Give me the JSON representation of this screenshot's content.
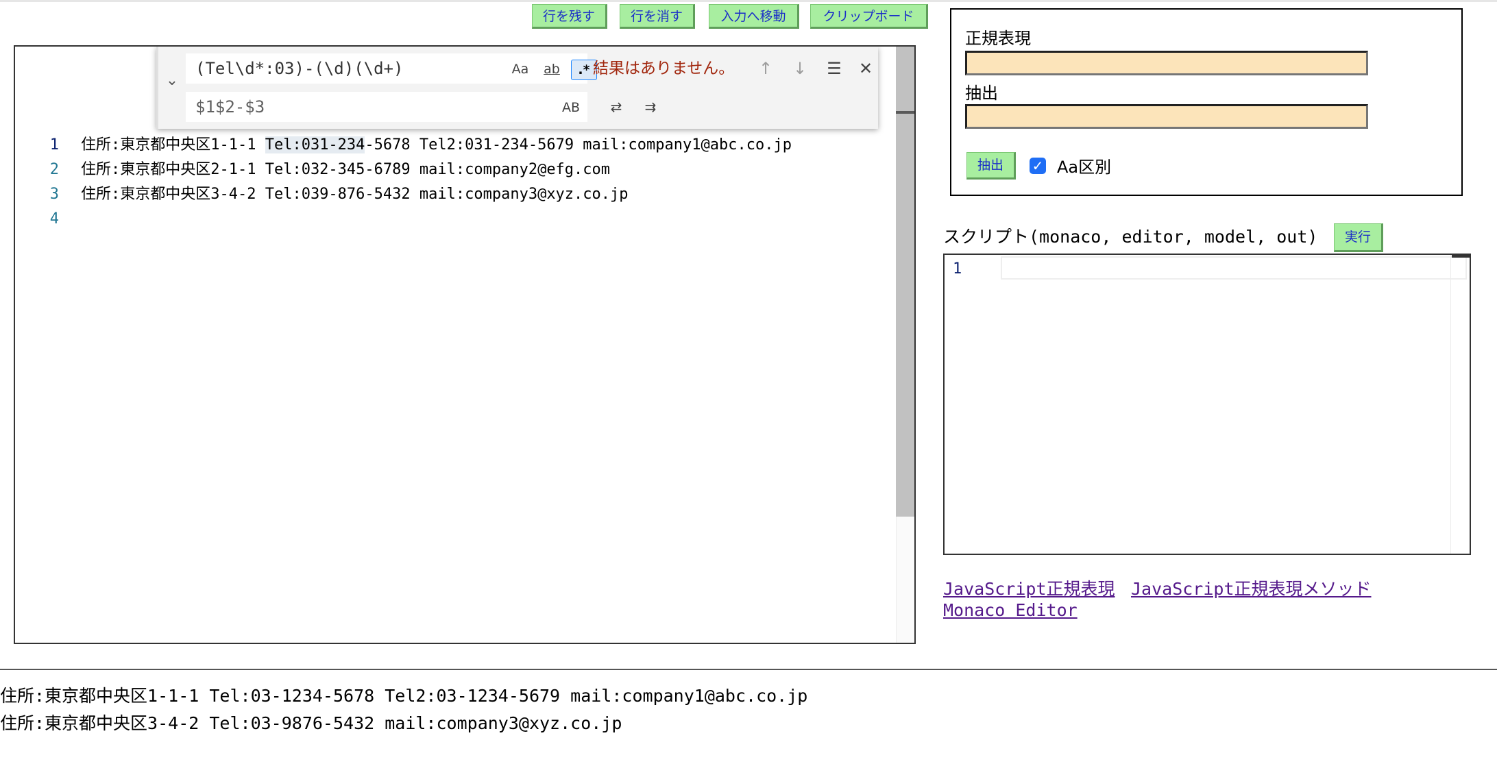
{
  "toolbar": {
    "keep_lines": "行を残す",
    "delete_lines": "行を消す",
    "go_to_input": "入力へ移動",
    "clipboard": "クリップボード"
  },
  "find_widget": {
    "search_value": "(Tel\\d*:03)-(\\d)(\\d+)",
    "replace_value": "$1$2-$3",
    "match_case_label": "Aa",
    "whole_word_label": "ab",
    "regex_label": ".*",
    "preserve_case_label": "AB",
    "result_message": "結果はありません。"
  },
  "editor": {
    "lines": [
      {
        "num": "1",
        "text": "住所:東京都中央区1-1-1 Tel:031-234-5678 Tel2:031-234-5679 mail:company1@abc.co.jp"
      },
      {
        "num": "2",
        "text": "住所:東京都中央区2-1-1 Tel:032-345-6789 mail:company2@efg.com"
      },
      {
        "num": "3",
        "text": "住所:東京都中央区3-4-2 Tel:039-876-5432 mail:company3@xyz.co.jp"
      },
      {
        "num": "4",
        "text": ""
      }
    ],
    "line1_pre": "住所:東京都中央区1-1-1 ",
    "line1_hl": "Tel:031-234",
    "line1_post": "-5678 Tel2:031-234-5679 mail:company1@abc.co.jp"
  },
  "regex_panel": {
    "regex_label": "正規表現",
    "regex_value": "",
    "extract_label": "抽出",
    "extract_value": "",
    "extract_button": "抽出",
    "case_label": "Aa区別",
    "case_checked": true
  },
  "script": {
    "label": "スクリプト(monaco, editor, model, out)",
    "run_button": "実行",
    "line_number": "1"
  },
  "links": {
    "js_regex": "JavaScript正規表現",
    "js_regex_methods": "JavaScript正規表現メソッド",
    "monaco": "Monaco Editor"
  },
  "output": {
    "lines": [
      "住所:東京都中央区1-1-1 Tel:03-1234-5678 Tel2:03-1234-5679 mail:company1@abc.co.jp",
      "住所:東京都中央区3-4-2 Tel:03-9876-5432 mail:company3@xyz.co.jp"
    ]
  }
}
